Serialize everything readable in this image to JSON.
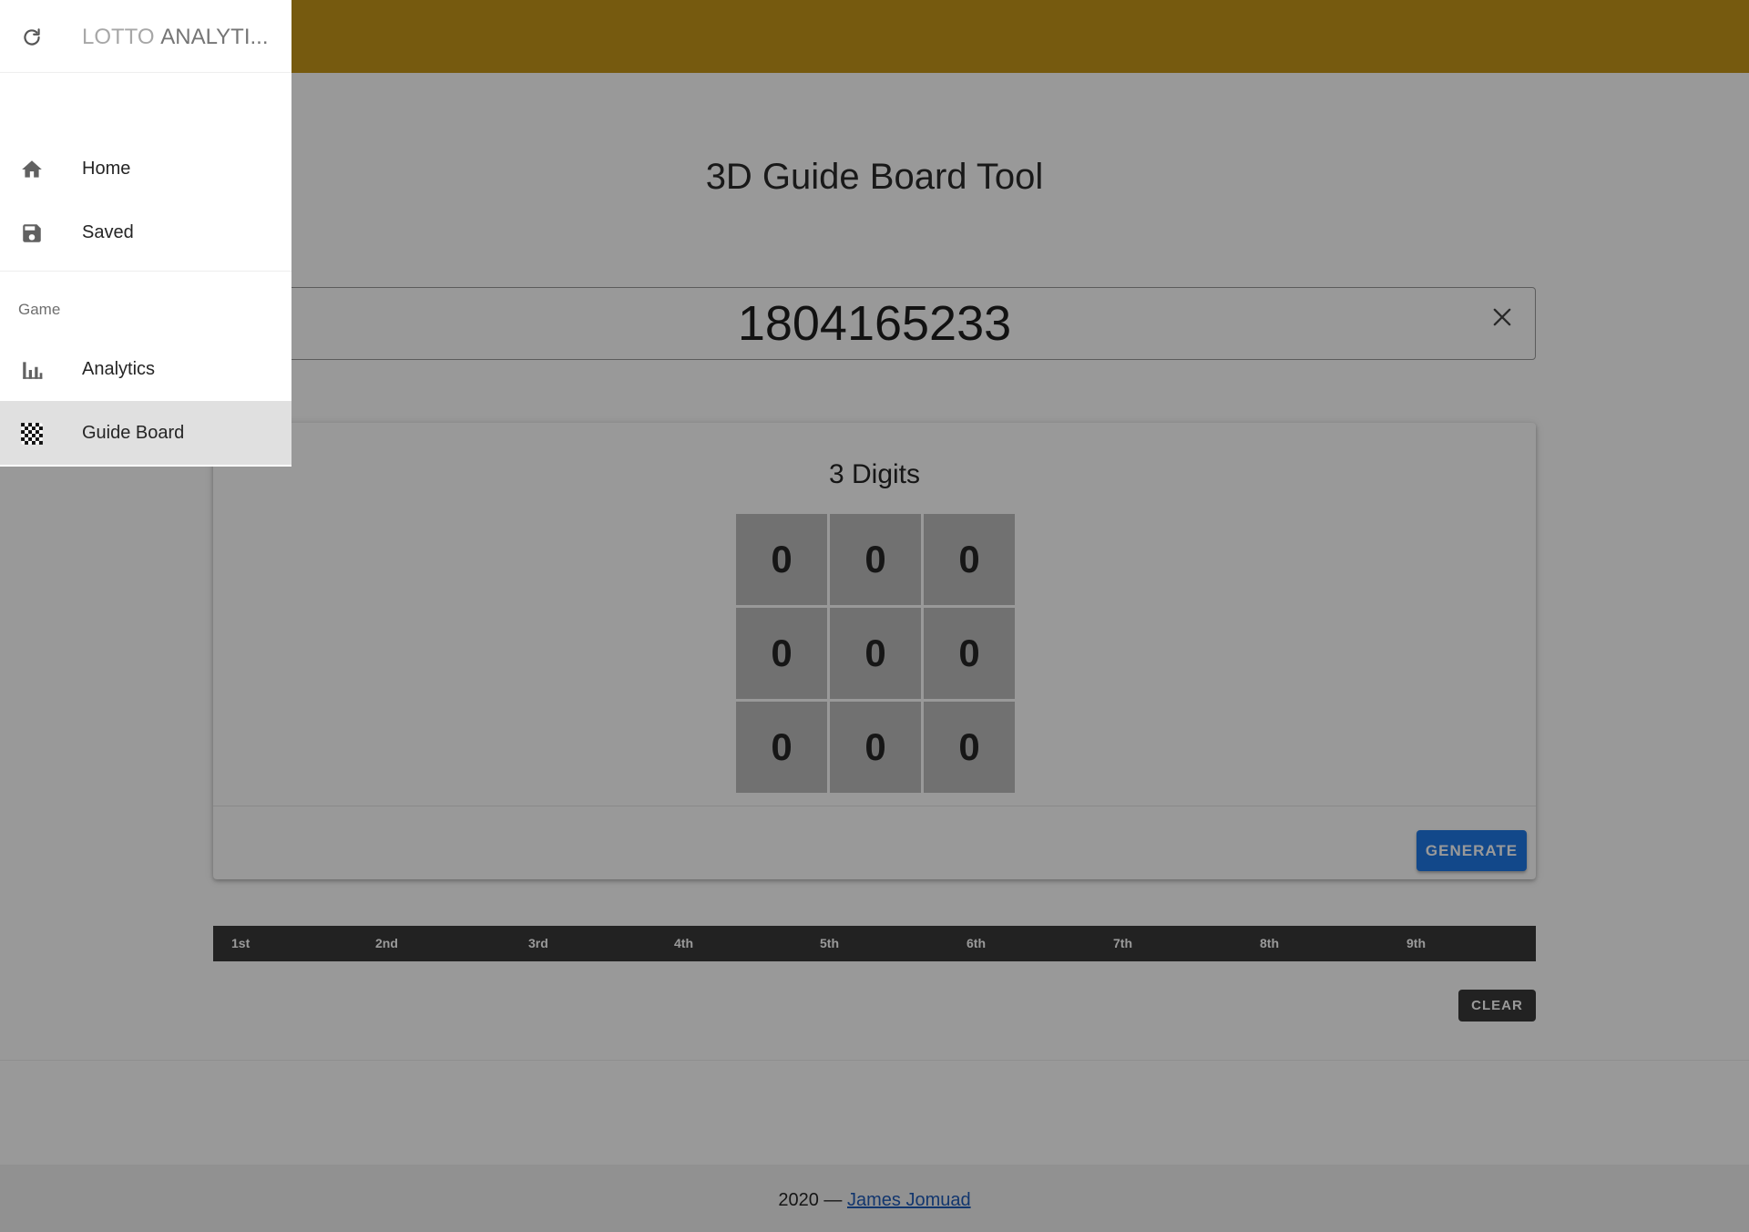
{
  "app": {
    "brand_part1": "LOTTO ",
    "brand_part2": "ANALYTI...",
    "header_color": "#c5961a"
  },
  "drawer": {
    "nav": [
      {
        "label": "Home",
        "icon": "home-icon"
      },
      {
        "label": "Saved",
        "icon": "save-icon"
      }
    ],
    "section_header": "Game",
    "game_items": [
      {
        "label": "Analytics",
        "icon": "bar-chart-icon"
      },
      {
        "label": "Guide Board",
        "icon": "checkerboard-icon",
        "active": true
      }
    ]
  },
  "main": {
    "title": "3D Guide Board Tool",
    "input": {
      "value": "1804165233"
    },
    "card": {
      "title": "3 Digits",
      "grid": [
        "0",
        "0",
        "0",
        "0",
        "0",
        "0",
        "0",
        "0",
        "0"
      ],
      "generate_label": "GENERATE"
    },
    "ranks": [
      "1st",
      "2nd",
      "3rd",
      "4th",
      "5th",
      "6th",
      "7th",
      "8th",
      "9th"
    ],
    "clear_label": "CLEAR"
  },
  "footer": {
    "prefix": "2020 — ",
    "author": "James Jomuad"
  }
}
